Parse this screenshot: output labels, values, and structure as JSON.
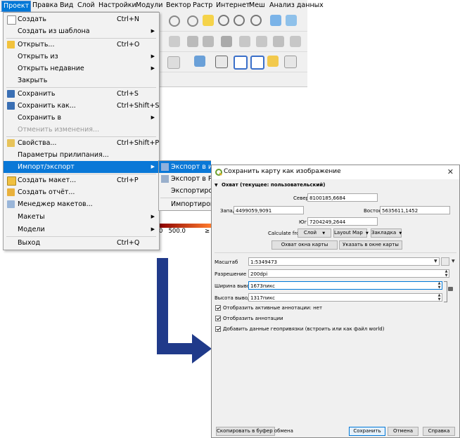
{
  "menubar": {
    "items": [
      "Проект",
      "Правка",
      "Вид",
      "Слой",
      "Настройки",
      "Модули",
      "Вектор",
      "Растр",
      "Интернет",
      "Меш",
      "Анализ данных"
    ]
  },
  "project_menu": {
    "items": [
      {
        "label": "Создать",
        "shortcut": "Ctrl+N"
      },
      {
        "label": "Создать из шаблона",
        "shortcut": ""
      },
      {
        "label": "Открыть...",
        "shortcut": "Ctrl+O"
      },
      {
        "label": "Открыть из",
        "shortcut": ""
      },
      {
        "label": "Открыть недавние",
        "shortcut": ""
      },
      {
        "label": "Закрыть",
        "shortcut": ""
      },
      {
        "label": "Сохранить",
        "shortcut": "Ctrl+S"
      },
      {
        "label": "Сохранить как...",
        "shortcut": "Ctrl+Shift+S"
      },
      {
        "label": "Сохранить в",
        "shortcut": ""
      },
      {
        "label": "Отменить изменения...",
        "shortcut": ""
      },
      {
        "label": "Свойства...",
        "shortcut": "Ctrl+Shift+P"
      },
      {
        "label": "Параметры прилипания...",
        "shortcut": ""
      },
      {
        "label": "Импорт/экспорт",
        "shortcut": ""
      },
      {
        "label": "Создать макет...",
        "shortcut": "Ctrl+P"
      },
      {
        "label": "Создать отчёт...",
        "shortcut": ""
      },
      {
        "label": "Менеджер макетов...",
        "shortcut": ""
      },
      {
        "label": "Макеты",
        "shortcut": ""
      },
      {
        "label": "Модели",
        "shortcut": ""
      },
      {
        "label": "Выход",
        "shortcut": "Ctrl+Q"
      }
    ]
  },
  "import_export_submenu": {
    "items": [
      "Экспорт в изображение",
      "Экспорт в PDF",
      "Экспортировать",
      "Импортировать"
    ]
  },
  "legend": {
    "values": "0   500.0",
    "more": "≥"
  },
  "dialog": {
    "title": "Сохранить карту как изображение",
    "extent_header": "Охват (текущее: пользовательский)",
    "north_label": "Север",
    "north_value": "8100185,6684",
    "west_label": "Запад",
    "west_value": "4499059,9091",
    "east_label": "Восток",
    "east_value": "5635611,1452",
    "south_label": "Юг",
    "south_value": "7204249,2644",
    "calculate_from_label": "Calculate from",
    "layer_btn": "Слой",
    "layout_map_btn": "Layout Map",
    "bookmark_btn": "Закладка",
    "map_extent_btn": "Охват окна карты",
    "draw_on_map_btn": "Указать в окне карты",
    "scale_label": "Масштаб",
    "scale_value": "1:5349473",
    "resolution_label": "Разрешение",
    "resolution_value": "200dpi",
    "width_label": "Ширина вывода",
    "width_value": "1673пикс",
    "height_label": "Высота вывода",
    "height_value": "1317пикс",
    "check_active_annotations": "Отобразить активные аннотации: нет",
    "check_annotations": "Отобразить аннотации",
    "check_georef": "Добавить данные геопривязки (встроить или как файл world)",
    "copy_clipboard_btn": "Скопировать в буфер обмена",
    "save_btn": "Сохранить",
    "cancel_btn": "Отмена",
    "help_btn": "Справка",
    "close_glyph": "✕"
  },
  "colors": {
    "highlight": "#0a78d7",
    "arrow": "#203a8a"
  }
}
